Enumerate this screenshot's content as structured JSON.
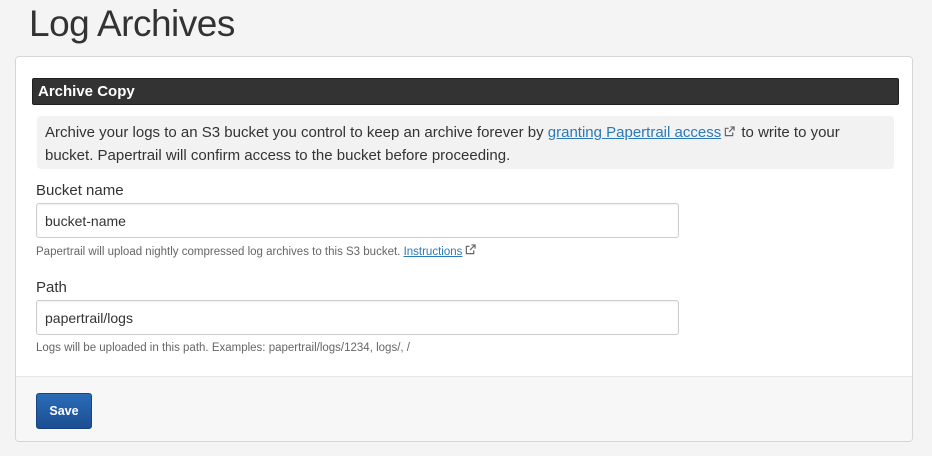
{
  "page": {
    "title": "Log Archives"
  },
  "section": {
    "title": "Archive Copy"
  },
  "notice": {
    "text_before": "Archive your logs to an S3 bucket you control to keep an archive forever by",
    "link_label": "granting Papertrail access",
    "text_after": "to write to your bucket. Papertrail will confirm access to the bucket before proceeding."
  },
  "bucket": {
    "label": "Bucket name",
    "value": "bucket-name",
    "help_text": "Papertrail will upload nightly compressed log archives to this S3 bucket.",
    "help_link_label": "Instructions"
  },
  "path": {
    "label": "Path",
    "value": "papertrail/logs",
    "help_text": "Logs will be uploaded in this path. Examples: papertrail/logs/1234, logs/, /"
  },
  "actions": {
    "save_label": "Save"
  },
  "colors": {
    "header_bg": "#333333",
    "link": "#2a7ab8",
    "button": "#1f5aa6"
  },
  "icons": {
    "external_link": "external-link-icon"
  }
}
